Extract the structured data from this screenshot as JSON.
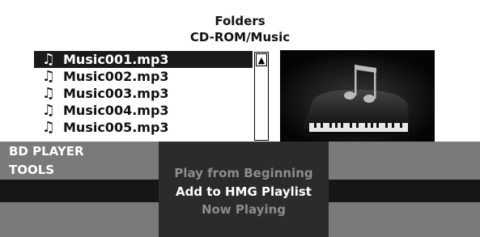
{
  "header": {
    "title": "Folders",
    "path": "CD-ROM/Music"
  },
  "file_list": {
    "items": [
      {
        "label": "Music001.mp3",
        "icon": "music-note-icon",
        "selected": true
      },
      {
        "label": "Music002.mp3",
        "icon": "music-note-icon",
        "selected": false
      },
      {
        "label": "Music003.mp3",
        "icon": "music-note-icon",
        "selected": false
      },
      {
        "label": "Music004.mp3",
        "icon": "music-note-icon",
        "selected": false
      },
      {
        "label": "Music005.mp3",
        "icon": "music-note-icon",
        "selected": false
      }
    ]
  },
  "player": {
    "line1": "BD PLAYER",
    "line2": "TOOLS"
  },
  "tools_menu": {
    "items": [
      {
        "label": "Play from Beginning",
        "state": "disabled"
      },
      {
        "label": "Add to HMG Playlist",
        "state": "highlighted"
      },
      {
        "label": "Now Playing",
        "state": "disabled"
      }
    ]
  },
  "colors": {
    "selection_bg": "#1a1a1a",
    "panel_gray": "#7a7a7a",
    "menu_bg": "#2b2b2b",
    "dim_text": "#8c8c8c"
  }
}
